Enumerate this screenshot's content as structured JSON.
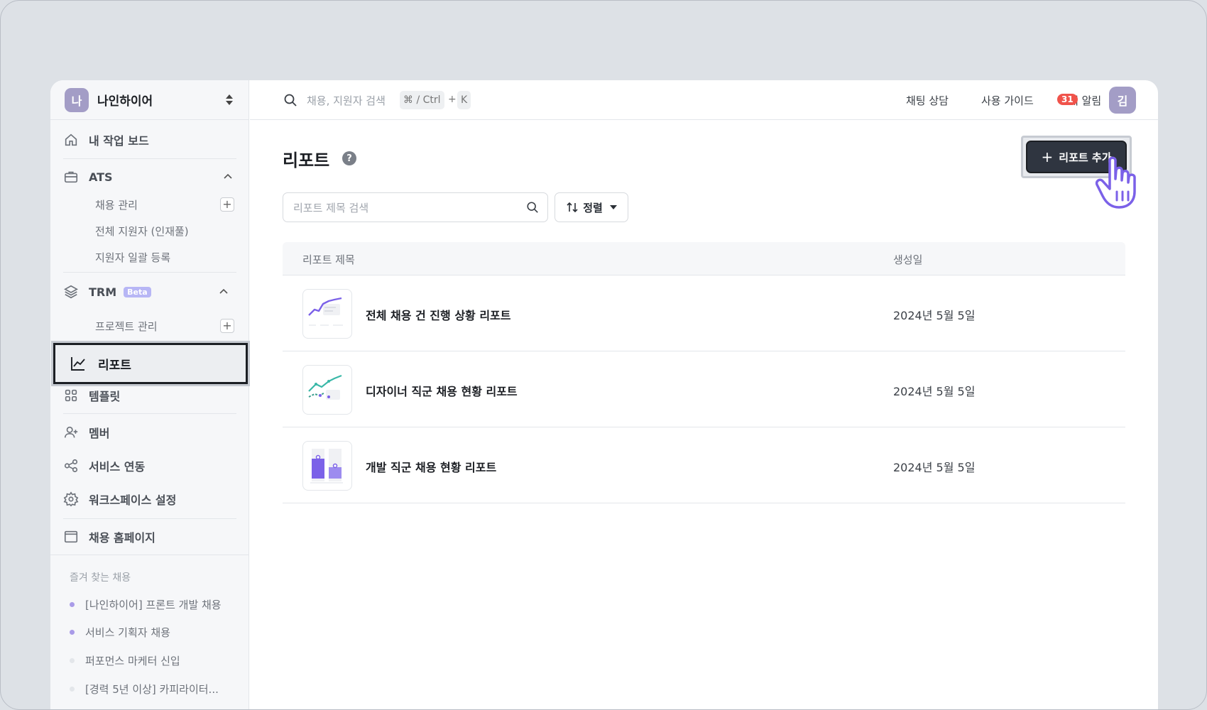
{
  "workspace": {
    "avatar": "나",
    "name": "나인하이어"
  },
  "sidebar": {
    "dashboard": "내 작업 보드",
    "ats": {
      "label": "ATS",
      "items": [
        "채용 관리",
        "전체 지원자 (인재풀)",
        "지원자 일괄 등록"
      ]
    },
    "trm": {
      "label": "TRM",
      "badge": "Beta",
      "items": [
        "프로젝트 관리"
      ]
    },
    "reports": "리포트",
    "templates": "템플릿",
    "members": "멤버",
    "integrations": "서비스 연동",
    "settings": "워크스페이스 설정",
    "homepage": "채용 홈페이지",
    "favorites_title": "즐겨 찾는 채용",
    "favorites": [
      {
        "label": "[나인하이어] 프론트 개발 채용",
        "color": "#a99be8"
      },
      {
        "label": "서비스 기획자 채용",
        "color": "#a99be8"
      },
      {
        "label": "퍼포먼스 마케터 신입",
        "color": "#e3e6ea"
      },
      {
        "label": "[경력 5년 이상] 카피라이터...",
        "color": "#e3e6ea"
      }
    ]
  },
  "header": {
    "search_placeholder": "채용, 지원자 검색",
    "shortcut_mod": "⌘ / Ctrl",
    "shortcut_plus": "+",
    "shortcut_key": "K",
    "chat": "채팅 상담",
    "guide": "사용 가이드",
    "notifications": "내 알림",
    "notification_count": "31",
    "user_avatar": "김"
  },
  "main": {
    "title": "리포트",
    "help": "?",
    "add_button": "리포트 추가",
    "search_placeholder": "리포트 제목 검색",
    "sort_label": "정렬",
    "columns": {
      "title": "리포트 제목",
      "created": "생성일"
    },
    "rows": [
      {
        "title": "전체 채용 건 진행 상황 리포트",
        "date": "2024년 5월 5일"
      },
      {
        "title": "디자이너 직군 채용 현황 리포트",
        "date": "2024년 5월 5일"
      },
      {
        "title": "개발 직군 채용 현황 리포트",
        "date": "2024년 5월 5일"
      }
    ]
  },
  "colors": {
    "accent": "#7b61e8",
    "primary_button": "#2f3540",
    "badge": "#f0534b"
  }
}
